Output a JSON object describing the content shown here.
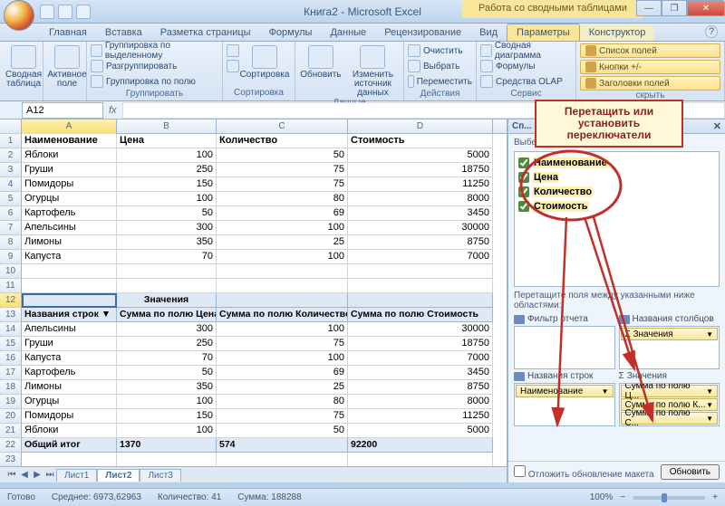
{
  "window": {
    "title": "Книга2 - Microsoft Excel",
    "contextual_title": "Работа со сводными таблицами"
  },
  "tabs": {
    "home": "Главная",
    "insert": "Вставка",
    "layout": "Разметка страницы",
    "formulas": "Формулы",
    "data": "Данные",
    "review": "Рецензирование",
    "view": "Вид",
    "options": "Параметры",
    "design": "Конструктор"
  },
  "ribbon": {
    "pivot_table": "Сводная таблица",
    "active_field": "Активное поле",
    "group_selection": "Группировка по выделенному",
    "ungroup": "Разгруппировать",
    "group_field": "Группировка по полю",
    "group_label": "Группировать",
    "sort_az": "А↓Я",
    "sort_za": "Я↓А",
    "sort": "Сортировка",
    "sort_label": "Сортировка",
    "refresh": "Обновить",
    "change_source": "Изменить источник данных",
    "data_label": "Данные",
    "clear": "Очистить",
    "select": "Выбрать",
    "move": "Переместить",
    "actions_label": "Действия",
    "pivot_chart": "Сводная диаграмма",
    "formulas_btn": "Формулы",
    "olap": "Средства OLAP",
    "tools_label": "Сервис",
    "field_list": "Список полей",
    "buttons_toggle": "Кнопки +/-",
    "field_headers": "Заголовки полей",
    "hide_label": "скрыть"
  },
  "namebox": "A12",
  "columns": [
    "A",
    "B",
    "C",
    "D"
  ],
  "data_rows": [
    {
      "r": "1",
      "a": "Наименование",
      "b": "Цена",
      "c": "Количество",
      "d": "Стоимость",
      "hdr": true
    },
    {
      "r": "2",
      "a": "Яблоки",
      "b": "100",
      "c": "50",
      "d": "5000"
    },
    {
      "r": "3",
      "a": "Груши",
      "b": "250",
      "c": "75",
      "d": "18750"
    },
    {
      "r": "4",
      "a": "Помидоры",
      "b": "150",
      "c": "75",
      "d": "11250"
    },
    {
      "r": "5",
      "a": "Огурцы",
      "b": "100",
      "c": "80",
      "d": "8000"
    },
    {
      "r": "6",
      "a": "Картофель",
      "b": "50",
      "c": "69",
      "d": "3450"
    },
    {
      "r": "7",
      "a": "Апельсины",
      "b": "300",
      "c": "100",
      "d": "30000"
    },
    {
      "r": "8",
      "a": "Лимоны",
      "b": "350",
      "c": "25",
      "d": "8750"
    },
    {
      "r": "9",
      "a": "Капуста",
      "b": "70",
      "c": "100",
      "d": "7000"
    },
    {
      "r": "10",
      "a": "",
      "b": "",
      "c": "",
      "d": ""
    }
  ],
  "pivot": {
    "values_label": "Значения",
    "row_labels_hdr": "Названия строк",
    "sum_price": "Сумма по полю Цена",
    "sum_qty": "Сумма по полю Количество",
    "sum_cost": "Сумма по полю Стоимость",
    "rows": [
      {
        "r": "14",
        "a": "Апельсины",
        "b": "300",
        "c": "100",
        "d": "30000"
      },
      {
        "r": "15",
        "a": "Груши",
        "b": "250",
        "c": "75",
        "d": "18750"
      },
      {
        "r": "16",
        "a": "Капуста",
        "b": "70",
        "c": "100",
        "d": "7000"
      },
      {
        "r": "17",
        "a": "Картофель",
        "b": "50",
        "c": "69",
        "d": "3450"
      },
      {
        "r": "18",
        "a": "Лимоны",
        "b": "350",
        "c": "25",
        "d": "8750"
      },
      {
        "r": "19",
        "a": "Огурцы",
        "b": "100",
        "c": "80",
        "d": "8000"
      },
      {
        "r": "20",
        "a": "Помидоры",
        "b": "150",
        "c": "75",
        "d": "11250"
      },
      {
        "r": "21",
        "a": "Яблоки",
        "b": "100",
        "c": "50",
        "d": "5000"
      }
    ],
    "total_row": {
      "r": "22",
      "a": "Общий итог",
      "b": "1370",
      "c": "574",
      "d": "92200"
    },
    "extra_row": "23"
  },
  "sheets": {
    "s1": "Лист1",
    "s2": "Лист2",
    "s3": "Лист3"
  },
  "pane": {
    "title": "Сп...",
    "choose_fields": "Выберите поля для добавления в отчет:",
    "f1": "Наименование",
    "f2": "Цена",
    "f3": "Количество",
    "f4": "Стоимость",
    "drag_label": "Перетащите поля между указанными ниже областями:",
    "report_filter": "Фильтр отчета",
    "col_labels": "Названия столбцов",
    "row_labels": "Названия строк",
    "values_area": "Значения",
    "values_sigma": "Σ Значения",
    "row_item": "Наименование",
    "v1": "Сумма по полю Ц...",
    "v2": "Сумма по полю К...",
    "v3": "Сумма по полю С...",
    "defer": "Отложить обновление макета",
    "update": "Обновить"
  },
  "status": {
    "ready": "Готово",
    "avg": "Среднее: 6973,62963",
    "count": "Количество: 41",
    "sum": "Сумма: 188288",
    "zoom": "100%"
  },
  "callout": "Перетащить или установить переключатели"
}
